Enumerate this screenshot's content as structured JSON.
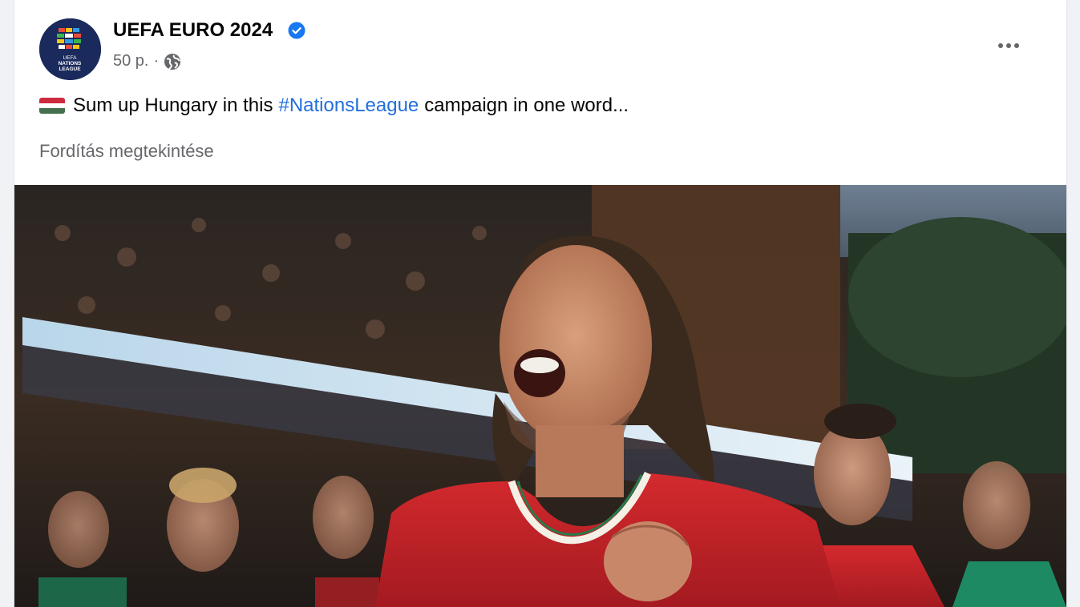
{
  "post": {
    "page_name": "UEFA EURO 2024",
    "verified_icon": "verified-badge-icon",
    "time": "50 p.",
    "separator": "·",
    "audience_icon": "globe-icon",
    "text_before": "Sum up Hungary in this",
    "hashtag": "#NationsLeague",
    "text_after": "campaign in one word...",
    "flag_icon": "hungary-flag-icon",
    "translate_link": "Fordítás megtekintése",
    "more_icon": "more-options-icon",
    "avatar": {
      "logo_lines": [
        "UEFA",
        "NATIONS",
        "LEAGUE"
      ]
    }
  },
  "colors": {
    "page_bg": "#f0f2f5",
    "card_bg": "#ffffff",
    "text_primary": "#050505",
    "text_secondary": "#65676b",
    "link": "#216fdb",
    "verified": "#1877f2",
    "avatar_bg": "#1b2a5c",
    "jersey_red": "#c8202a"
  }
}
